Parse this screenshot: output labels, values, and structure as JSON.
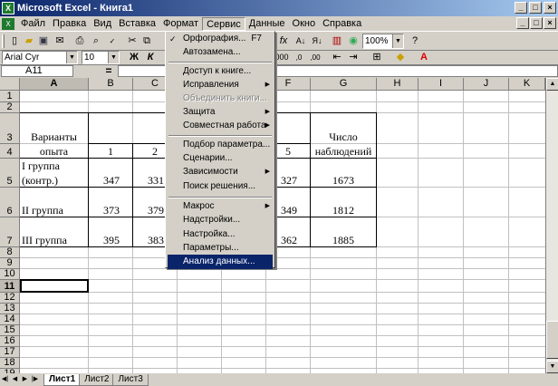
{
  "window": {
    "title": "Microsoft Excel - Книга1"
  },
  "menubar": [
    "Файл",
    "Правка",
    "Вид",
    "Вставка",
    "Формат",
    "Сервис",
    "Данные",
    "Окно",
    "Справка"
  ],
  "toolbar": {
    "zoom": "100%",
    "font": "Arial Cyr",
    "size": "10",
    "num_format": "000"
  },
  "formula_bar": {
    "name_box": "A11",
    "eq": "=",
    "value": ""
  },
  "columns": [
    "A",
    "B",
    "C",
    "D",
    "E",
    "F",
    "G",
    "H",
    "I",
    "J",
    "K"
  ],
  "rows": [
    "1",
    "2",
    "3",
    "4",
    "5",
    "6",
    "7",
    "8",
    "9",
    "10",
    "11",
    "12",
    "13",
    "14",
    "15",
    "16",
    "17",
    "18",
    "19"
  ],
  "cells": {
    "a3": "Варианты",
    "a4": "опыта",
    "b4": "1",
    "c4": "2",
    "f4": "5",
    "g3": "Число",
    "g4": "наблюдений",
    "a5a": "I группа",
    "a5b": "(контр.)",
    "b5": "347",
    "c5": "331",
    "f5": "327",
    "g5": "1673",
    "a6": "II группа",
    "b6": "373",
    "c6": "379",
    "f6": "349",
    "g6": "1812",
    "a7": "III группа",
    "b7": "395",
    "c7": "383",
    "f7": "362",
    "g7": "1885"
  },
  "service_menu": {
    "spelling": "Орфография...",
    "spelling_key": "F7",
    "autocorrect": "Автозамена...",
    "share": "Доступ к книге...",
    "track": "Исправления",
    "merge": "Объединить книги...",
    "protect": "Защита",
    "online": "Совместная работа",
    "goalseek": "Подбор параметра...",
    "scenarios": "Сценарии...",
    "audit": "Зависимости",
    "solver": "Поиск решения...",
    "macro": "Макрос",
    "addins": "Надстройки...",
    "customize": "Настройка...",
    "options": "Параметры...",
    "analysis": "Анализ данных..."
  },
  "sheets": [
    "Лист1",
    "Лист2",
    "Лист3"
  ]
}
